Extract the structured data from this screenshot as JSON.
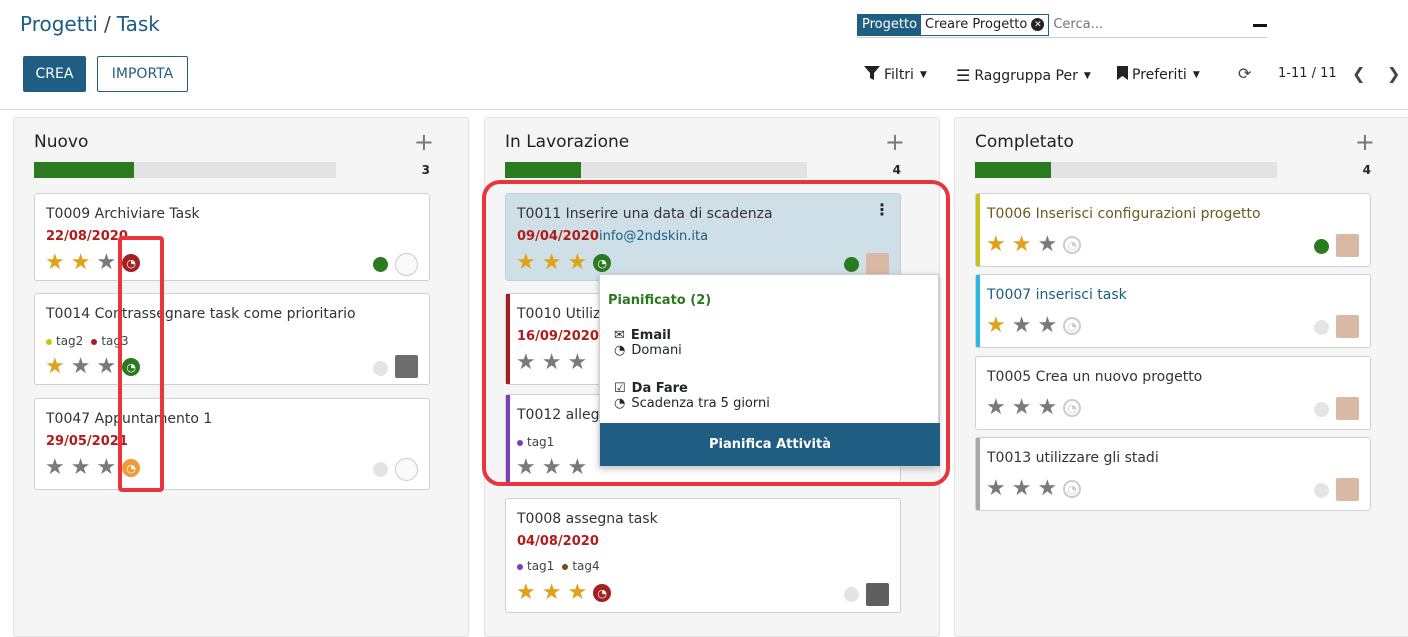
{
  "breadcrumb": {
    "parent": "Progetti",
    "separator": "/",
    "current": "Task"
  },
  "toolbar": {
    "create": "CREA",
    "import": "IMPORTA"
  },
  "search": {
    "facet_label": "Progetto",
    "facet_value": "Creare Progetto",
    "placeholder": "Cerca..."
  },
  "filters": {
    "filters": "Filtri",
    "group_by": "Raggruppa Per",
    "favorites": "Preferiti"
  },
  "pager": {
    "range": "1-11 / 11"
  },
  "columns": [
    {
      "title": "Nuovo",
      "count": "3",
      "progress": 0.33
    },
    {
      "title": "In Lavorazione",
      "count": "4",
      "progress": 0.25
    },
    {
      "title": "Completato",
      "count": "4",
      "progress": 0.25
    }
  ],
  "cards": {
    "t0009": {
      "title": "T0009 Archiviare Task",
      "date": "22/08/2020"
    },
    "t0014": {
      "title": "T0014 Contrassegnare task come prioritario",
      "tag1": "tag2",
      "tag2": "tag3"
    },
    "t0047": {
      "title": "T0047 Appuntamento 1",
      "date": "29/05/2021"
    },
    "t0011": {
      "title": "T0011 Inserire una data di scadenza",
      "date": "09/04/2020",
      "email": "info@2ndskin.ita"
    },
    "t0010": {
      "title": "T0010 Utilizzare le date",
      "date": "16/09/2020"
    },
    "t0012": {
      "title": "T0012 allegati",
      "tag1": "tag1"
    },
    "t0008": {
      "title": "T0008 assegna task",
      "date": "04/08/2020",
      "tag1": "tag1",
      "tag2": "tag4"
    },
    "t0006": {
      "title": "T0006 Inserisci configurazioni progetto"
    },
    "t0007": {
      "title": "T0007 inserisci task"
    },
    "t0005": {
      "title": "T0005 Crea un nuovo progetto"
    },
    "t0013": {
      "title": "T0013 utilizzare gli stadi"
    }
  },
  "popover": {
    "header": "Pianificato (2)",
    "activity1_type": "Email",
    "activity1_when": "Domani",
    "activity2_type": "Da Fare",
    "activity2_when": "Scadenza tra 5 giorni",
    "footer": "Pianifica Attività"
  },
  "colors": {
    "brand": "#1f5d82",
    "progress": "#2a7a1f",
    "overdue": "#b01c1c",
    "highlight": "#e8363c"
  }
}
